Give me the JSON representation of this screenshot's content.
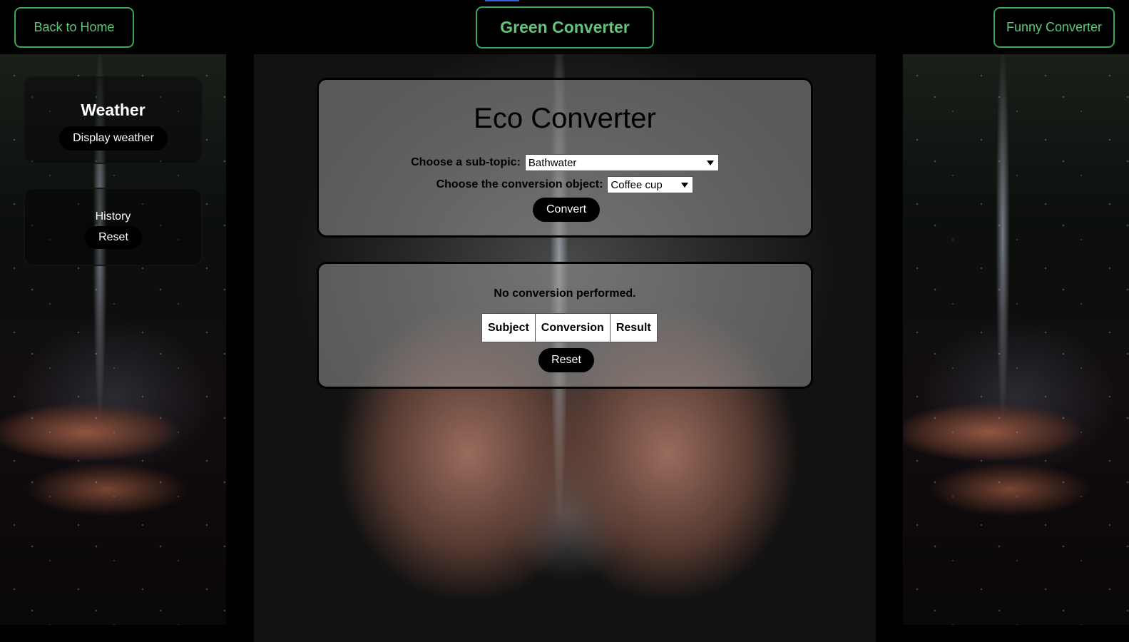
{
  "nav": {
    "back_label": "Back to Home",
    "title": "Green Converter",
    "funny_label": "Funny Converter",
    "accent_color": "#5cc878"
  },
  "weather": {
    "title": "Weather",
    "button_label": "Display weather"
  },
  "history": {
    "label": "History",
    "reset_label": "Reset"
  },
  "converter": {
    "heading": "Eco Converter",
    "subtopic_label": "Choose a sub-topic:",
    "subtopic_value": "Bathwater",
    "object_label": "Choose the conversion object:",
    "object_value": "Coffee cup",
    "convert_label": "Convert"
  },
  "result": {
    "status": "No conversion performed.",
    "columns": [
      "Subject",
      "Conversion",
      "Result"
    ],
    "reset_label": "Reset"
  }
}
